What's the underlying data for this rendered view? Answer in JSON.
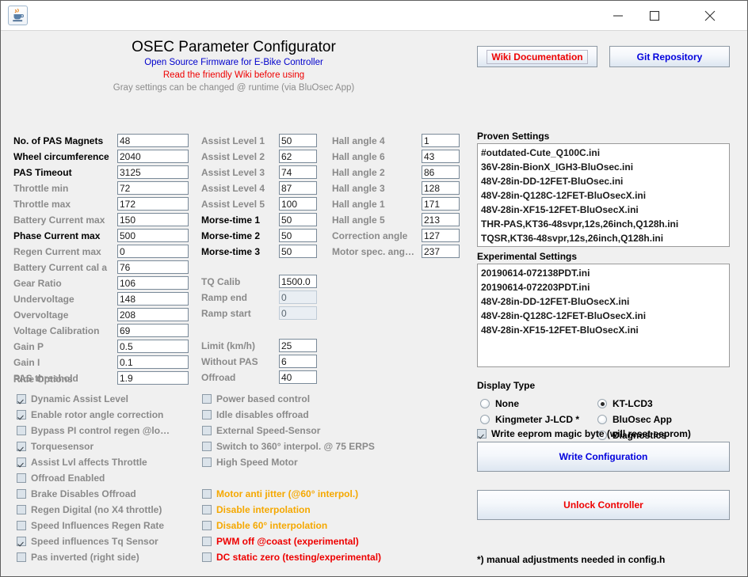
{
  "window": {
    "title": "",
    "icon": "java-coffee-cup-icon",
    "minimize_label": "─",
    "maximize_label": "□",
    "close_label": "✕"
  },
  "header": {
    "title": "OSEC Parameter Configurator",
    "subtitle_blue": "Open Source Firmware for E-Bike Controller",
    "subtitle_red": "Read the friendly Wiki before using",
    "subtitle_gray": "Gray settings can be changed @ runtime (via BluOsec App)"
  },
  "links": {
    "wiki_label": "Wiki Documentation",
    "git_label": "Git Repository"
  },
  "colors": {
    "blue": "#0000dd",
    "red": "#ee0000",
    "orange": "#f5a800",
    "gray": "#8a8a8a"
  },
  "params_left": [
    {
      "label": "No. of PAS Magnets",
      "value": "48",
      "runtime": false
    },
    {
      "label": "Wheel circumference",
      "value": "2040",
      "runtime": false
    },
    {
      "label": "PAS Timeout",
      "value": "3125",
      "runtime": false
    },
    {
      "label": "Throttle min",
      "value": "72",
      "runtime": true
    },
    {
      "label": "Throttle max",
      "value": "172",
      "runtime": true
    },
    {
      "label": "Battery Current max",
      "value": "150",
      "runtime": true
    },
    {
      "label": "Phase Current max",
      "value": "500",
      "runtime": false
    },
    {
      "label": "Regen Current max",
      "value": "0",
      "runtime": true
    },
    {
      "label": "Battery Current cal a",
      "value": "76",
      "runtime": true
    },
    {
      "label": "Gear Ratio",
      "value": "106",
      "runtime": true
    },
    {
      "label": "Undervoltage",
      "value": "148",
      "runtime": true
    },
    {
      "label": "Overvoltage",
      "value": "208",
      "runtime": true
    },
    {
      "label": "Voltage Calibration",
      "value": "69",
      "runtime": true
    },
    {
      "label": "Gain P",
      "value": "0.5",
      "runtime": true
    },
    {
      "label": "Gain I",
      "value": "0.1",
      "runtime": true
    },
    {
      "label": "PAS threshold",
      "value": "1.9",
      "runtime": true
    }
  ],
  "params_mid": [
    {
      "label": "Assist Level 1",
      "value": "50",
      "runtime": true
    },
    {
      "label": "Assist Level 2",
      "value": "62",
      "runtime": true
    },
    {
      "label": "Assist Level 3",
      "value": "74",
      "runtime": true
    },
    {
      "label": "Assist Level 4",
      "value": "87",
      "runtime": true
    },
    {
      "label": "Assist Level 5",
      "value": "100",
      "runtime": true
    },
    {
      "label": "Morse-time 1",
      "value": "50",
      "runtime": false
    },
    {
      "label": "Morse-time 2",
      "value": "50",
      "runtime": false
    },
    {
      "label": "Morse-time 3",
      "value": "50",
      "runtime": false
    }
  ],
  "params_tq": [
    {
      "label": "TQ Calib",
      "value": "1500.0",
      "runtime": true,
      "disabled": false
    },
    {
      "label": "Ramp end",
      "value": "0",
      "runtime": true,
      "disabled": true
    },
    {
      "label": "Ramp start",
      "value": "0",
      "runtime": true,
      "disabled": true
    }
  ],
  "params_limit": [
    {
      "label": "Limit (km/h)",
      "value": "25",
      "runtime": true
    },
    {
      "label": "Without PAS",
      "value": "6",
      "runtime": true
    },
    {
      "label": "Offroad",
      "value": "40",
      "runtime": true
    }
  ],
  "params_hall": [
    {
      "label": "Hall angle 4",
      "value": "1",
      "runtime": true
    },
    {
      "label": "Hall angle 6",
      "value": "43",
      "runtime": true
    },
    {
      "label": "Hall angle 2",
      "value": "86",
      "runtime": true
    },
    {
      "label": "Hall angle 3",
      "value": "128",
      "runtime": true
    },
    {
      "label": "Hall angle 1",
      "value": "171",
      "runtime": true
    },
    {
      "label": "Hall angle 5",
      "value": "213",
      "runtime": true
    },
    {
      "label": "Correction angle",
      "value": "127",
      "runtime": true
    },
    {
      "label": "Motor spec. ang…",
      "value": "237",
      "runtime": true
    }
  ],
  "ride_options": {
    "title": "Ride Options",
    "items": [
      {
        "label": "Dynamic Assist Level",
        "checked": true,
        "color": "gray"
      },
      {
        "label": "Enable rotor angle correction",
        "checked": true,
        "color": "gray"
      },
      {
        "label": "Bypass PI control regen @lo…",
        "checked": false,
        "color": "gray"
      },
      {
        "label": "Torquesensor",
        "checked": true,
        "color": "gray"
      },
      {
        "label": "Assist Lvl affects Throttle",
        "checked": true,
        "color": "gray"
      },
      {
        "label": "Offroad Enabled",
        "checked": false,
        "color": "gray"
      },
      {
        "label": "Brake Disables Offroad",
        "checked": false,
        "color": "gray"
      },
      {
        "label": "Regen Digital (no X4 throttle)",
        "checked": false,
        "color": "gray"
      },
      {
        "label": "Speed Influences Regen Rate",
        "checked": false,
        "color": "gray"
      },
      {
        "label": "Speed influences Tq Sensor",
        "checked": true,
        "color": "gray"
      },
      {
        "label": "Pas inverted (right side)",
        "checked": false,
        "color": "gray"
      }
    ]
  },
  "motor_options": {
    "items": [
      {
        "label": "Power based control",
        "checked": false,
        "color": "gray"
      },
      {
        "label": "Idle disables offroad",
        "checked": false,
        "color": "gray"
      },
      {
        "label": "External Speed-Sensor",
        "checked": false,
        "color": "gray"
      },
      {
        "label": "Switch to 360° interpol. @ 75 ERPS",
        "checked": false,
        "color": "gray"
      },
      {
        "label": "High Speed Motor",
        "checked": false,
        "color": "gray"
      }
    ],
    "experimental": [
      {
        "label": "Motor anti jitter (@60° interpol.)",
        "checked": false,
        "color": "orange"
      },
      {
        "label": "Disable interpolation",
        "checked": false,
        "color": "orange"
      },
      {
        "label": "Disable 60° interpolation",
        "checked": false,
        "color": "orange"
      },
      {
        "label": "PWM off @coast (experimental)",
        "checked": false,
        "color": "red"
      },
      {
        "label": "DC static zero (testing/experimental)",
        "checked": false,
        "color": "red"
      }
    ]
  },
  "proven_settings": {
    "title": "Proven Settings",
    "items": [
      "#outdated-Cute_Q100C.ini",
      "36V-28in-BionX_IGH3-BluOsec.ini",
      "48V-28in-DD-12FET-BluOsec.ini",
      "48V-28in-Q128C-12FET-BluOsecX.ini",
      "48V-28in-XF15-12FET-BluOsecX.ini",
      "THR-PAS,KT36-48svpr,12s,26inch,Q128h.ini",
      "TQSR,KT36-48svpr,12s,26inch,Q128h.ini"
    ]
  },
  "experimental_settings": {
    "title": "Experimental Settings",
    "items": [
      "20190614-072138PDT.ini",
      "20190614-072203PDT.ini",
      "48V-28in-DD-12FET-BluOsecX.ini",
      "48V-28in-Q128C-12FET-BluOsecX.ini",
      "48V-28in-XF15-12FET-BluOsecX.ini"
    ]
  },
  "display_type": {
    "title": "Display Type",
    "options": [
      {
        "label": "None",
        "selected": false
      },
      {
        "label": "KT-LCD3",
        "selected": true
      },
      {
        "label": "Kingmeter J-LCD *",
        "selected": false
      },
      {
        "label": "BluOsec App",
        "selected": false
      },
      {
        "label": "Diagnostics",
        "selected": false
      }
    ]
  },
  "eeprom": {
    "label": "Write eeprom magic byte (will reset eeprom)",
    "checked": true
  },
  "actions": {
    "write_label": "Write Configuration",
    "unlock_label": "Unlock Controller"
  },
  "footnote": "*) manual adjustments needed in config.h"
}
